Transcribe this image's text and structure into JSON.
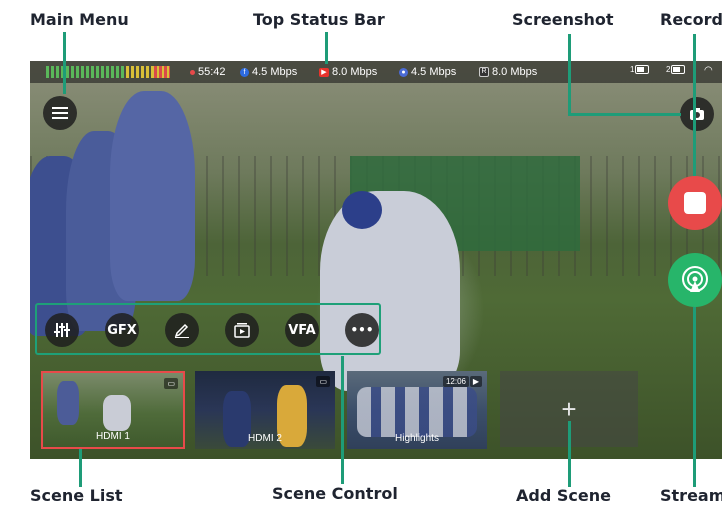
{
  "callouts": {
    "main_menu": "Main Menu",
    "top_status_bar": "Top Status Bar",
    "screenshot": "Screenshot",
    "record": "Record",
    "scene_list": "Scene List",
    "scene_control": "Scene Control",
    "add_scene": "Add Scene",
    "stream": "Stream"
  },
  "status_bar": {
    "timer": "55:42",
    "facebook_bitrate": "4.5 Mbps",
    "youtube_bitrate": "8.0 Mbps",
    "third_bitrate": "4.5 Mbps",
    "record_bitrate": "8.0 Mbps",
    "battery_1": "1",
    "battery_2": "2",
    "record_icon_letter": "R"
  },
  "scene_control": {
    "buttons": [
      "audio-mixer-icon",
      "GFX",
      "pen-icon",
      "playback-icon",
      "VFA",
      "more-icon"
    ],
    "gfx_label": "GFX",
    "vfa_label": "VFA",
    "more_label": "•••"
  },
  "scenes": [
    {
      "label": "HDMI 1",
      "selected": true
    },
    {
      "label": "HDMI 2",
      "selected": false
    },
    {
      "label": "Highlights",
      "selected": false,
      "badge": "12:06"
    }
  ],
  "add_scene_label": "+",
  "colors": {
    "callout_line": "#1e9c78",
    "record_button": "#e84a4a",
    "stream_button": "#27b56a",
    "selected_scene_border": "#e84a4a"
  }
}
